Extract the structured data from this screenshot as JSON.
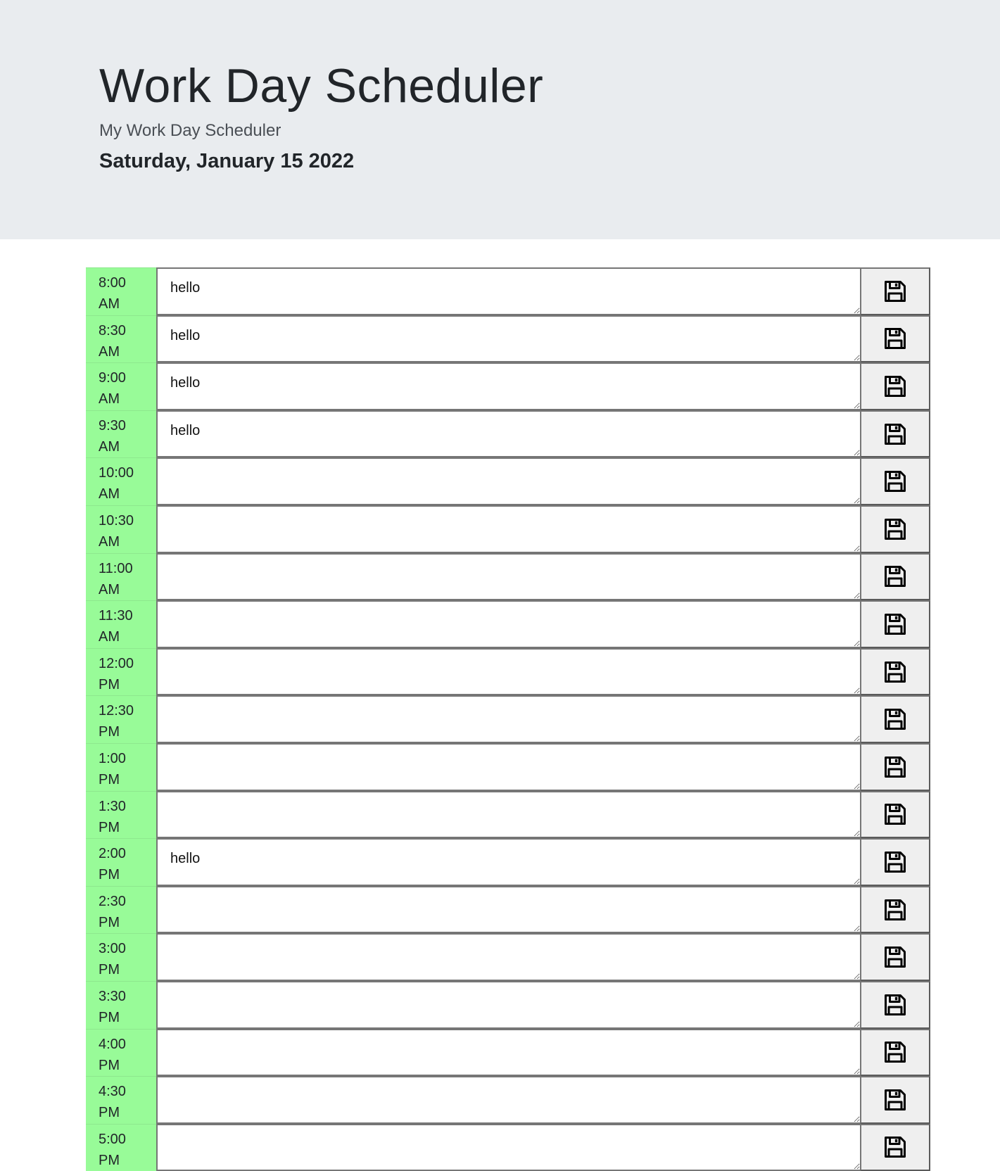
{
  "header": {
    "title": "Work Day Scheduler",
    "subtitle": "My Work Day Scheduler",
    "date": "Saturday, January 15 2022"
  },
  "colors": {
    "header_bg": "#e9ecef",
    "time_block_bg": "#98fb98",
    "save_button_bg": "#efefef"
  },
  "time_blocks": [
    {
      "time": "8:00",
      "period": "AM",
      "text": "hello"
    },
    {
      "time": "8:30",
      "period": "AM",
      "text": "hello"
    },
    {
      "time": "9:00",
      "period": "AM",
      "text": "hello"
    },
    {
      "time": "9:30",
      "period": "AM",
      "text": "hello"
    },
    {
      "time": "10:00",
      "period": "AM",
      "text": ""
    },
    {
      "time": "10:30",
      "period": "AM",
      "text": ""
    },
    {
      "time": "11:00",
      "period": "AM",
      "text": ""
    },
    {
      "time": "11:30",
      "period": "AM",
      "text": ""
    },
    {
      "time": "12:00",
      "period": "PM",
      "text": ""
    },
    {
      "time": "12:30",
      "period": "PM",
      "text": ""
    },
    {
      "time": "1:00",
      "period": "PM",
      "text": ""
    },
    {
      "time": "1:30",
      "period": "PM",
      "text": ""
    },
    {
      "time": "2:00",
      "period": "PM",
      "text": "hello"
    },
    {
      "time": "2:30",
      "period": "PM",
      "text": ""
    },
    {
      "time": "3:00",
      "period": "PM",
      "text": ""
    },
    {
      "time": "3:30",
      "period": "PM",
      "text": ""
    },
    {
      "time": "4:00",
      "period": "PM",
      "text": ""
    },
    {
      "time": "4:30",
      "period": "PM",
      "text": ""
    },
    {
      "time": "5:00",
      "period": "PM",
      "text": ""
    }
  ],
  "save_icon": "floppy-disk-icon"
}
